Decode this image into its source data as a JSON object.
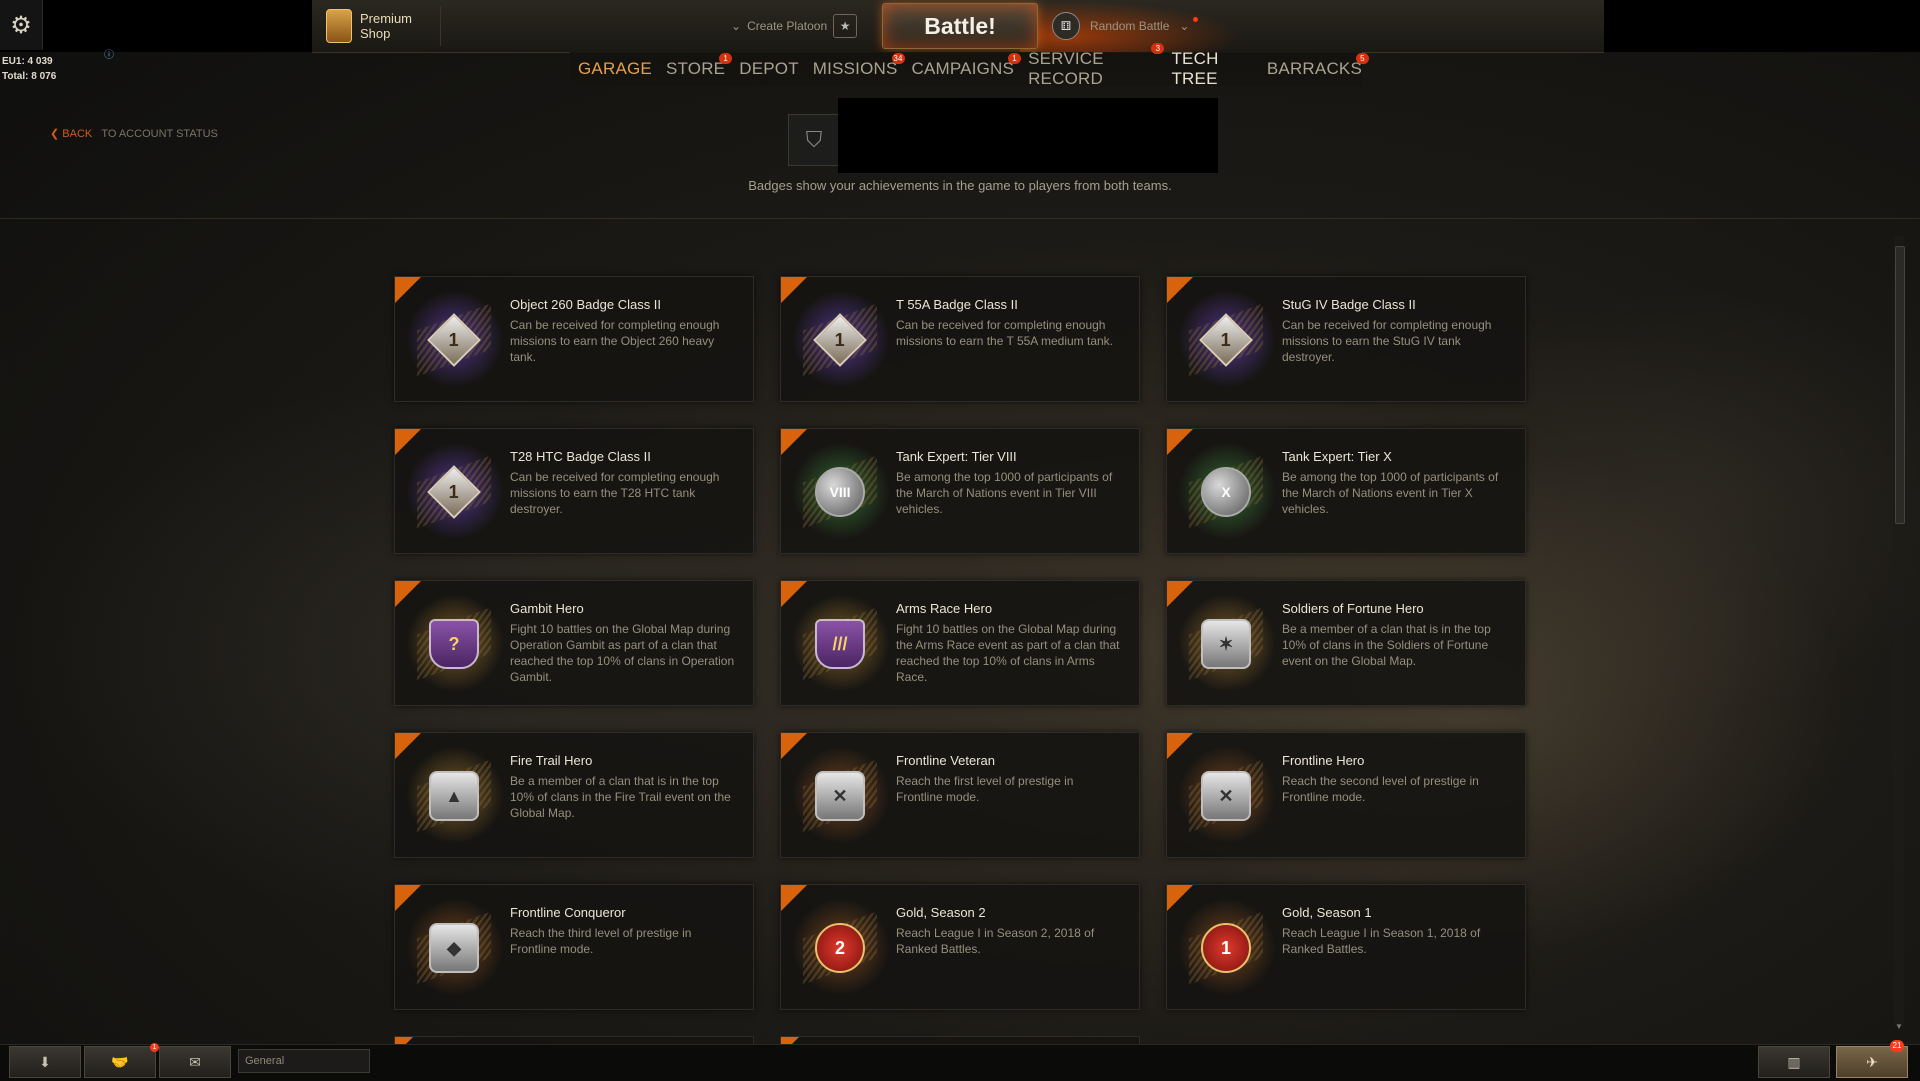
{
  "topbar": {
    "premium_line1": "Premium",
    "premium_line2": "Shop",
    "create_platoon": "Create Platoon",
    "battle": "Battle!",
    "mode": "Random Battle"
  },
  "nav": {
    "items": [
      {
        "label": "GARAGE",
        "count": ""
      },
      {
        "label": "STORE",
        "count": "1"
      },
      {
        "label": "DEPOT",
        "count": ""
      },
      {
        "label": "MISSIONS",
        "count": "34"
      },
      {
        "label": "CAMPAIGNS",
        "count": "1"
      },
      {
        "label": "SERVICE RECORD",
        "count": "3"
      },
      {
        "label": "TECH TREE",
        "count": ""
      },
      {
        "label": "BARRACKS",
        "count": "5"
      }
    ]
  },
  "stats": {
    "line1": "EU1: 4 039",
    "line2": "Total: 8 076"
  },
  "back": {
    "label": "BACK",
    "sub": "TO ACCOUNT STATUS"
  },
  "header": {
    "description": "Badges show your achievements in the game to players from both teams."
  },
  "badges": [
    {
      "title": "Object 260 Badge Class II",
      "desc": "Can be received for completing enough missions to earn the Object 260 heavy tank.",
      "icon": "diamond",
      "glyph": "1",
      "glow": "purple",
      "icon_name": "class-1-diamond-icon"
    },
    {
      "title": "T 55A Badge Class II",
      "desc": "Can be received for completing enough missions to earn the T 55A medium tank.",
      "icon": "diamond",
      "glyph": "1",
      "glow": "purple",
      "icon_name": "class-1-diamond-icon"
    },
    {
      "title": "StuG IV Badge Class II",
      "desc": "Can be received for completing enough missions to earn the StuG IV tank destroyer.",
      "icon": "diamond",
      "glyph": "1",
      "glow": "purple",
      "icon_name": "class-1-diamond-icon"
    },
    {
      "title": "T28 HTC Badge Class II",
      "desc": "Can be received for completing enough missions to earn the T28 HTC tank destroyer.",
      "icon": "diamond",
      "glyph": "1",
      "glow": "purple",
      "icon_name": "class-1-diamond-icon"
    },
    {
      "title": "Tank Expert: Tier VIII",
      "desc": "Be among the top 1000 of participants of the March of Nations event in Tier VIII vehicles.",
      "icon": "globe",
      "glyph": "VIII",
      "glow": "green",
      "icon_name": "globe-tier-icon"
    },
    {
      "title": "Tank Expert: Tier X",
      "desc": "Be among the top 1000 of participants of the March of Nations event in Tier X vehicles.",
      "icon": "globe",
      "glyph": "X",
      "glow": "green",
      "icon_name": "globe-tier-icon"
    },
    {
      "title": "Gambit Hero",
      "desc": "Fight 10 battles on the Global Map during Operation Gambit as part of a clan that reached the top 10% of clans in Operation Gambit.",
      "icon": "shield",
      "glyph": "?",
      "glow": "gold",
      "icon_name": "winged-shield-icon"
    },
    {
      "title": "Arms Race Hero",
      "desc": "Fight 10 battles on the Global Map during the Arms Race event as part of a clan that reached the top 10% of clans in Arms Race.",
      "icon": "shield",
      "glyph": "///",
      "glow": "gold",
      "icon_name": "shells-shield-icon"
    },
    {
      "title": "Soldiers of Fortune Hero",
      "desc": "Be a member of a clan that is in the top 10% of clans in the Soldiers of Fortune event on the Global Map.",
      "icon": "silver",
      "glyph": "✶",
      "glow": "gold",
      "icon_name": "eagle-icon"
    },
    {
      "title": "Fire Trail Hero",
      "desc": "Be a member of a clan that is in the top 10% of clans in the Fire Trail event on the Global Map.",
      "icon": "silver",
      "glyph": "▲",
      "glow": "gold",
      "icon_name": "blade-crest-icon"
    },
    {
      "title": "Frontline Veteran",
      "desc": "Reach the first level of prestige in Frontline mode.",
      "icon": "silver",
      "glyph": "✕",
      "glow": "orange",
      "icon_name": "crossed-swords-icon"
    },
    {
      "title": "Frontline Hero",
      "desc": "Reach the second level of prestige in Frontline mode.",
      "icon": "silver",
      "glyph": "✕",
      "glow": "orange",
      "icon_name": "crossed-swords-icon"
    },
    {
      "title": "Frontline Conqueror",
      "desc": "Reach the third level of prestige in Frontline mode.",
      "icon": "silver",
      "glyph": "◆",
      "glow": "orange",
      "icon_name": "laurel-emblem-icon"
    },
    {
      "title": "Gold, Season 2",
      "desc": "Reach League I in Season 2, 2018 of Ranked Battles.",
      "icon": "red",
      "glyph": "2",
      "glow": "orange",
      "icon_name": "ranked-shield-icon"
    },
    {
      "title": "Gold, Season 1",
      "desc": "Reach League I in Season 1, 2018 of Ranked Battles.",
      "icon": "red",
      "glyph": "1",
      "glow": "orange",
      "icon_name": "ranked-shield-icon"
    }
  ],
  "chat": {
    "channel": "General",
    "notif_count": "1",
    "notifications_count": "21"
  },
  "colors": {
    "accent": "#d9620c",
    "nav_active": "#e5a04b",
    "alert": "#d5310f"
  }
}
